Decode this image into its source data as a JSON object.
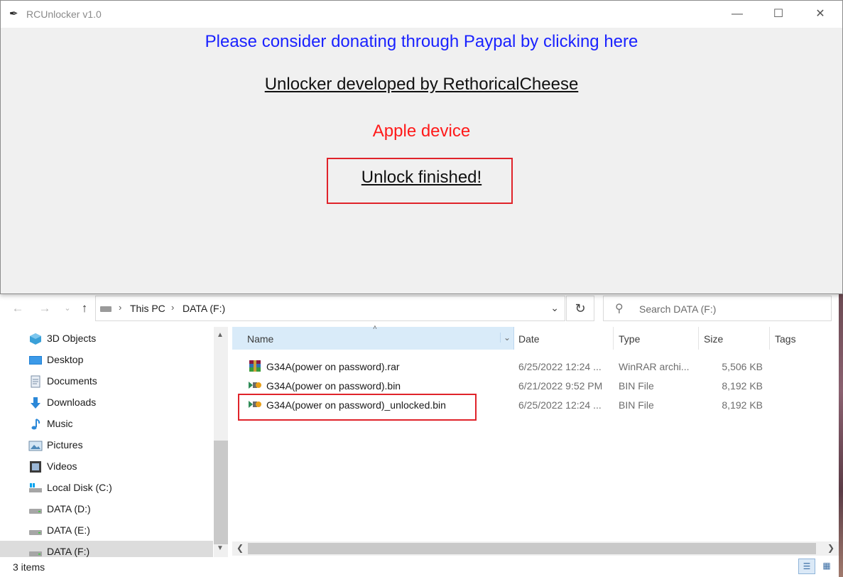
{
  "rcunlocker": {
    "title": "RCUnlocker v1.0",
    "donate_text": "Please consider donating through Paypal by clicking here",
    "developer_text": "Unlocker developed by RethoricalCheese",
    "device_text": "Apple device",
    "status_text": "Unlock finished!",
    "colors": {
      "donate": "#1a22ff",
      "device": "#ff1a1a",
      "highlight": "#e0232a"
    }
  },
  "explorer": {
    "breadcrumb": [
      "This PC",
      "DATA (F:)"
    ],
    "search_placeholder": "Search DATA (F:)",
    "tree": [
      {
        "label": "3D Objects",
        "icon": "3d-objects-icon"
      },
      {
        "label": "Desktop",
        "icon": "desktop-icon"
      },
      {
        "label": "Documents",
        "icon": "documents-icon"
      },
      {
        "label": "Downloads",
        "icon": "downloads-icon"
      },
      {
        "label": "Music",
        "icon": "music-icon"
      },
      {
        "label": "Pictures",
        "icon": "pictures-icon"
      },
      {
        "label": "Videos",
        "icon": "videos-icon"
      },
      {
        "label": "Local Disk (C:)",
        "icon": "local-disk-icon"
      },
      {
        "label": "DATA (D:)",
        "icon": "drive-icon"
      },
      {
        "label": "DATA (E:)",
        "icon": "drive-icon"
      },
      {
        "label": "DATA (F:)",
        "icon": "drive-icon",
        "selected": true
      }
    ],
    "columns": {
      "name": "Name",
      "date": "Date",
      "type": "Type",
      "size": "Size",
      "tags": "Tags"
    },
    "files": [
      {
        "name": "G34A(power on password).rar",
        "date": "6/25/2022 12:24 ...",
        "type": "WinRAR archi...",
        "size": "5,506 KB",
        "icon": "winrar-archive-icon"
      },
      {
        "name": "G34A(power on password).bin",
        "date": "6/21/2022 9:52 PM",
        "type": "BIN File",
        "size": "8,192 KB",
        "icon": "bin-file-icon"
      },
      {
        "name": "G34A(power on password)_unlocked.bin",
        "date": "6/25/2022 12:24 ...",
        "type": "BIN File",
        "size": "8,192 KB",
        "icon": "bin-file-icon",
        "highlighted": true
      }
    ],
    "status": "3 items"
  }
}
